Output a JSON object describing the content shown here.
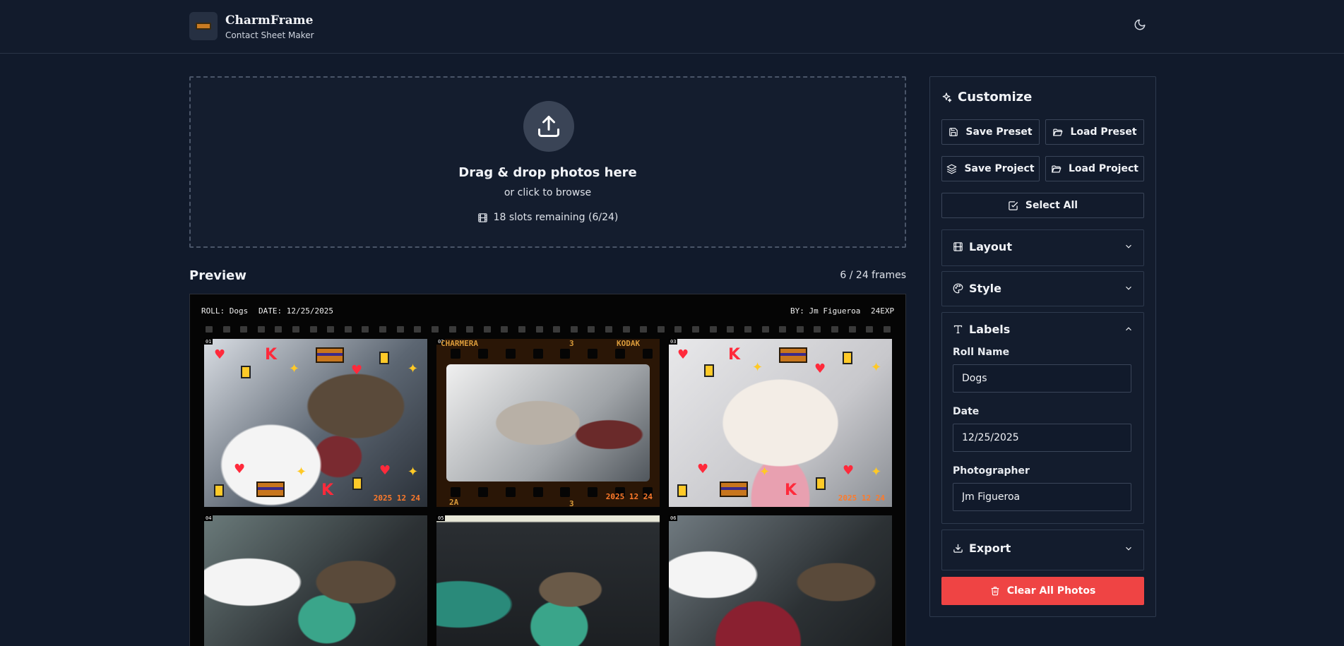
{
  "header": {
    "app_title": "CharmFrame",
    "app_subtitle": "Contact Sheet Maker",
    "theme_icon": "moon-icon"
  },
  "dropzone": {
    "title": "Drag & drop photos here",
    "subtitle": "or click to browse",
    "slots_text": "18 slots remaining (6/24)",
    "icon": "upload-icon"
  },
  "preview": {
    "title": "Preview",
    "frame_count": "6 / 24 frames"
  },
  "sheet": {
    "roll_label": "ROLL: Dogs",
    "date_label": "DATE: 12/25/2025",
    "by_label": "BY: Jm Figueroa",
    "exposures": "24EXP",
    "frames": [
      {
        "num": "01",
        "stamp": "2025 12 24"
      },
      {
        "num": "02",
        "stamp": "2025 12 24",
        "film_top_left": "CHARMERA",
        "film_top_mid": "3",
        "film_top_right": "KODAK",
        "film_bottom_left": "2A",
        "film_bottom_mid": "3"
      },
      {
        "num": "03",
        "stamp": "2025 12 24"
      },
      {
        "num": "04",
        "stamp": ""
      },
      {
        "num": "05",
        "stamp": ""
      },
      {
        "num": "06",
        "stamp": ""
      }
    ]
  },
  "sidebar": {
    "title": "Customize",
    "save_preset": "Save Preset",
    "load_preset": "Load Preset",
    "save_project": "Save Project",
    "load_project": "Load Project",
    "select_all": "Select All",
    "sections": {
      "layout": "Layout",
      "style": "Style",
      "labels": "Labels",
      "export": "Export"
    },
    "labels": {
      "roll_name_label": "Roll Name",
      "roll_name_value": "Dogs",
      "date_label": "Date",
      "date_value": "12/25/2025",
      "photographer_label": "Photographer",
      "photographer_value": "Jm Figueroa"
    },
    "clear_all": "Clear All Photos"
  },
  "colors": {
    "background": "#111a2b",
    "accent_danger": "#ef4444",
    "date_stamp": "#ff7a2a"
  }
}
